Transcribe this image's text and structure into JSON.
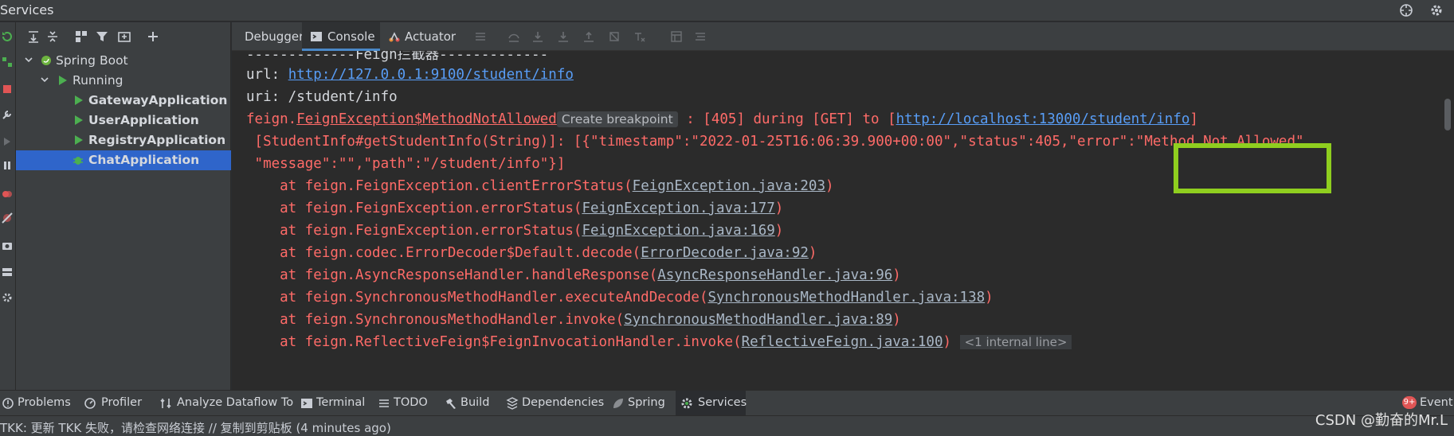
{
  "window": {
    "title": "Services"
  },
  "tree": {
    "nodes": [
      {
        "label": "Spring Boot",
        "bold": false
      },
      {
        "label": "Running",
        "bold": false
      },
      {
        "label": "GatewayApplication",
        "bold": true
      },
      {
        "label": "UserApplication",
        "bold": true
      },
      {
        "label": "RegistryApplication",
        "bold": true
      },
      {
        "label": "ChatApplication",
        "bold": true,
        "selected": true
      }
    ]
  },
  "console_tabs": {
    "debugger": "Debugger",
    "console": "Console",
    "actuator": "Actuator"
  },
  "console": {
    "line0": "-------------Feign拦截器-------------",
    "line1_prefix": "url: ",
    "line1_link": "http://127.0.0.1:9100/student/info",
    "line2": "uri: /student/info",
    "line3_a": "feign.",
    "line3_b": "FeignException$MethodNotAllowed",
    "line3_hint": "Create breakpoint",
    "line3_c": " : [405] during [GET] to [",
    "line3_link": "http://localhost:13000/student/info",
    "line3_d": "]",
    "line4": " [StudentInfo#getStudentInfo(String)]: [{\"timestamp\":\"2022-01-25T16:06:39.900+00:00\",\"status\":405,\"error\":\"Method Not Allowed\"",
    "line5": " \"message\":\"\",\"path\":\"/student/info\"}]",
    "stack": [
      {
        "pre": "    at feign.FeignException.clientErrorStatus(",
        "src": "FeignException.java:203",
        "post": ")"
      },
      {
        "pre": "    at feign.FeignException.errorStatus(",
        "src": "FeignException.java:177",
        "post": ")"
      },
      {
        "pre": "    at feign.FeignException.errorStatus(",
        "src": "FeignException.java:169",
        "post": ")"
      },
      {
        "pre": "    at feign.codec.ErrorDecoder$Default.decode(",
        "src": "ErrorDecoder.java:92",
        "post": ")"
      },
      {
        "pre": "    at feign.AsyncResponseHandler.handleResponse(",
        "src": "AsyncResponseHandler.java:96",
        "post": ")"
      },
      {
        "pre": "    at feign.SynchronousMethodHandler.executeAndDecode(",
        "src": "SynchronousMethodHandler.java:138",
        "post": ")"
      },
      {
        "pre": "    at feign.SynchronousMethodHandler.invoke(",
        "src": "SynchronousMethodHandler.java:89",
        "post": ")"
      },
      {
        "pre": "    at feign.ReflectiveFeign$FeignInvocationHandler.invoke(",
        "src": "ReflectiveFeign.java:100",
        "post": ")"
      }
    ],
    "internal_tag": "<1 internal line>"
  },
  "bottom_tabs": {
    "problems": "Problems",
    "profiler": "Profiler",
    "analyze": "Analyze Dataflow To",
    "terminal": "Terminal",
    "todo": "TODO",
    "build": "Build",
    "dependencies": "Dependencies",
    "spring": "Spring",
    "services": "Services",
    "event_badge": "9+",
    "event_log": "Event L"
  },
  "status": {
    "message": "TKK: 更新 TKK 失败，请检查网络连接 // 复制到剪贴板 (4 minutes ago)"
  },
  "watermark": "CSDN @勤奋的Mr.L",
  "colors": {
    "error_text": "#ff6b68",
    "link": "#589df6",
    "highlight_box": "#8fce1f",
    "selection": "#2f65ca",
    "run_green": "#4caf50"
  }
}
